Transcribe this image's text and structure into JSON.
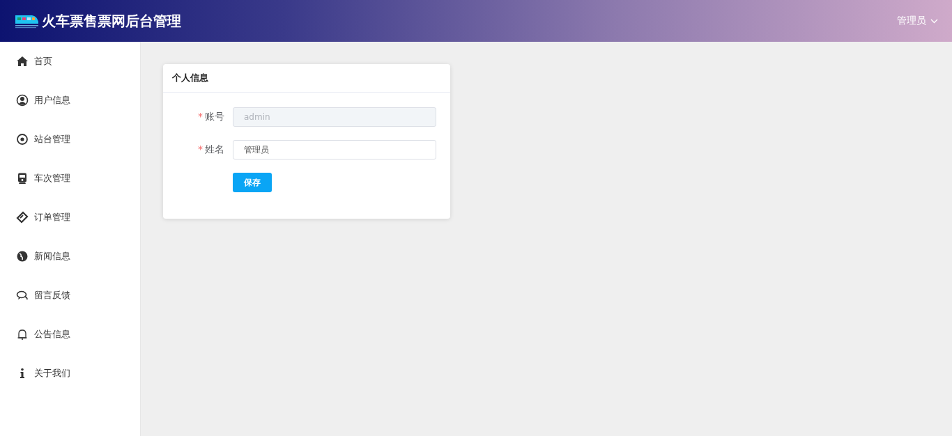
{
  "header": {
    "title": "火车票售票网后台管理",
    "user_menu": {
      "label": "管理员"
    }
  },
  "sidebar": {
    "items": [
      {
        "label": "首页"
      },
      {
        "label": "用户信息"
      },
      {
        "label": "站台管理"
      },
      {
        "label": "车次管理"
      },
      {
        "label": "订单管理"
      },
      {
        "label": "新闻信息"
      },
      {
        "label": "留言反馈"
      },
      {
        "label": "公告信息"
      },
      {
        "label": "关于我们"
      }
    ]
  },
  "card": {
    "title": "个人信息",
    "fields": [
      {
        "required_mark": "*",
        "label": "账号",
        "value": "admin",
        "disabled": true
      },
      {
        "required_mark": "*",
        "label": "姓名",
        "value": "管理员",
        "disabled": false
      }
    ],
    "buttons": [
      {
        "label": "保存"
      }
    ]
  }
}
